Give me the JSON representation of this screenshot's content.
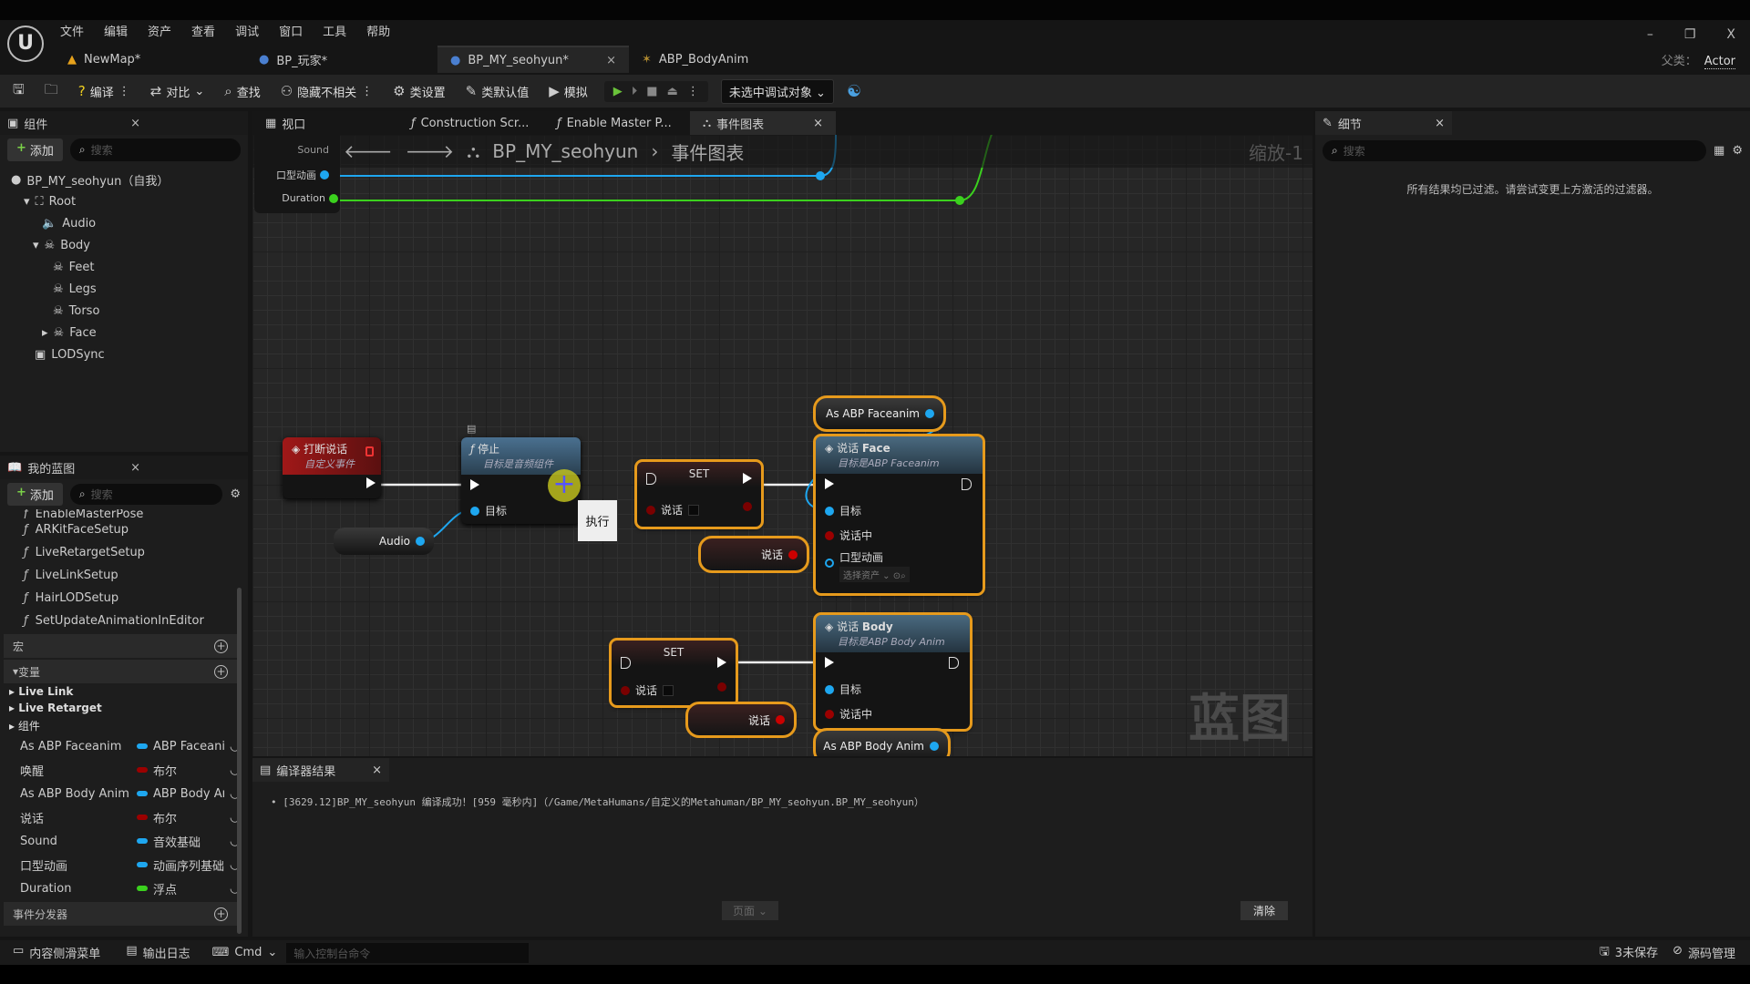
{
  "menu": [
    "文件",
    "编辑",
    "资产",
    "查看",
    "调试",
    "窗口",
    "工具",
    "帮助"
  ],
  "tabs": [
    {
      "label": "NewMap*",
      "icon": "level-icon"
    },
    {
      "label": "BP_玩家*",
      "icon": "blueprint-icon"
    },
    {
      "label": "BP_MY_seohyun*",
      "icon": "blueprint-icon",
      "active": true
    },
    {
      "label": "ABP_BodyAnim",
      "icon": "anim-blueprint-icon"
    }
  ],
  "window": {
    "parent_label": "父类：",
    "parent_value": "Actor",
    "minimize": "–",
    "restore": "❐",
    "close": "X"
  },
  "toolbar": {
    "compile": "编译",
    "diff": "对比",
    "find": "查找",
    "hide_unrelated": "隐藏不相关",
    "class_settings": "类设置",
    "class_defaults": "类默认值",
    "simulate": "模拟",
    "debug_target": "未选中调试对象"
  },
  "components": {
    "title": "组件",
    "add": "添加",
    "search_placeholder": "搜索",
    "root_item": "BP_MY_seohyun（自我）",
    "items": [
      "Root",
      "Audio",
      "Body",
      "Feet",
      "Legs",
      "Torso",
      "Face",
      "LODSync"
    ]
  },
  "my_blueprint": {
    "title": "我的蓝图",
    "add": "添加",
    "search_placeholder": "搜索",
    "functions": [
      "EnableMasterPose",
      "ARKitFaceSetup",
      "LiveRetargetSetup",
      "LiveLinkSetup",
      "HairLODSetup",
      "SetUpdateAnimationInEditor"
    ],
    "macros": "宏",
    "variables": "变量",
    "groups": [
      "Live Link",
      "Live Retarget",
      "组件"
    ],
    "vars": [
      {
        "name": "As ABP Faceanim",
        "type": "ABP Faceanim",
        "color": "#1ea7f0"
      },
      {
        "name": "唤醒",
        "type": "布尔",
        "color": "#9b0000"
      },
      {
        "name": "As ABP Body Anim",
        "type": "ABP Body Anim",
        "color": "#1ea7f0"
      },
      {
        "name": "说话",
        "type": "布尔",
        "color": "#9b0000"
      },
      {
        "name": "Sound",
        "type": "音效基础",
        "color": "#1ea7f0"
      },
      {
        "name": "口型动画",
        "type": "动画序列基础",
        "color": "#1ea7f0"
      },
      {
        "name": "Duration",
        "type": "浮点",
        "color": "#3bd11e"
      }
    ],
    "dispatchers": "事件分发器"
  },
  "graph_tabs": [
    {
      "label": "视口"
    },
    {
      "label": "Construction Scr..."
    },
    {
      "label": "Enable Master P..."
    },
    {
      "label": "事件图表",
      "active": true
    }
  ],
  "breadcrumb": {
    "root": "BP_MY_seohyun",
    "current": "事件图表"
  },
  "zoom": "缩放-1",
  "watermark": "蓝图",
  "nodes": {
    "top_pins": [
      "Sound",
      "口型动画",
      "Duration"
    ],
    "interrupt": {
      "title": "打断说话",
      "subtitle": "自定义事件"
    },
    "stop": {
      "title": "停止",
      "subtitle": "目标是音频组件",
      "target": "目标"
    },
    "audio": "Audio",
    "tooltip": "执行",
    "set1": {
      "title": "SET",
      "var": "说话"
    },
    "get1": "说话",
    "faceanim": "As ABP Faceanim",
    "talk_face": {
      "title_a": "说话",
      "title_b": "Face",
      "subtitle": "目标是ABP Faceanim",
      "target": "目标",
      "talking": "说话中",
      "lip": "口型动画",
      "asset": "选择资产"
    },
    "set2": {
      "title": "SET",
      "var": "说话"
    },
    "get2": "说话",
    "talk_body": {
      "title_a": "说话",
      "title_b": "Body",
      "subtitle": "目标是ABP Body Anim",
      "target": "目标",
      "talking": "说话中"
    },
    "bodyanim": "As ABP Body Anim"
  },
  "details": {
    "title": "细节",
    "search_placeholder": "搜索",
    "empty": "所有结果均已过滤。请尝试变更上方激活的过滤器。"
  },
  "compiler": {
    "title": "编译器结果",
    "message": "[3629.12]BP_MY_seohyun 编译成功！[959 毫秒内]（/Game/MetaHumans/自定义的Metahuman/BP_MY_seohyun.BP_MY_seohyun）",
    "page": "页面",
    "clear": "清除"
  },
  "status": {
    "content_drawer": "内容侧滑菜单",
    "output_log": "输出日志",
    "cmd": "Cmd",
    "console_placeholder": "输入控制台命令",
    "unsaved": "3未保存",
    "source_control": "源码管理"
  }
}
